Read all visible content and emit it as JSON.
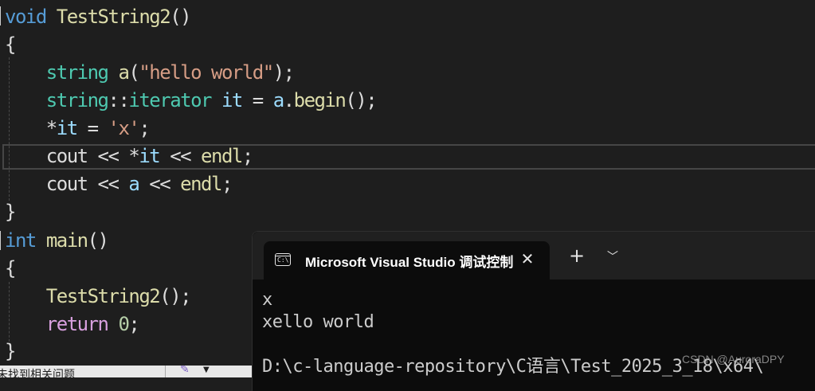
{
  "editor": {
    "func1_kw": "void",
    "func1_name": "TestString2",
    "func1_parens": "()",
    "open_brace": "{",
    "close_brace": "}",
    "l3_type": "string",
    "l3_var": "a",
    "l3_open": "(",
    "l3_str": "\"hello world\"",
    "l3_close": ");",
    "l4_type": "string",
    "l4_scope": "::",
    "l4_iter": "iterator",
    "l4_var": "it",
    "l4_eq": " = ",
    "l4_obj": "a",
    "l4_dot": ".",
    "l4_fn": "begin",
    "l4_end": "();",
    "l5_star": "*",
    "l5_var": "it",
    "l5_eq": " = ",
    "l5_char": "'x'",
    "l5_semi": ";",
    "l6_cout": "cout",
    "l6_op1": " << ",
    "l6_star": "*",
    "l6_var": "it",
    "l6_op2": " << ",
    "l6_endl": "endl",
    "l6_semi": ";",
    "l7_cout": "cout",
    "l7_op1": " << ",
    "l7_var": "a",
    "l7_op2": " << ",
    "l7_endl": "endl",
    "l7_semi": ";",
    "main_kw": "int",
    "main_name": "main",
    "main_parens": "()",
    "l11_fn": "TestString2",
    "l11_rest": "();",
    "l12_kw": "return",
    "l12_num": "0",
    "l12_semi": ";"
  },
  "statusbar": {
    "issues_label": "未找到相关问题"
  },
  "console": {
    "tab_icon_text": "C:\\",
    "tab_title": "Microsoft Visual Studio 调试控制台",
    "tab_close_icon": "close-icon",
    "new_tab_icon": "plus-icon",
    "dropdown_icon": "chevron-down-icon",
    "output": [
      "x",
      "xello world",
      "",
      "D:\\c-language-repository\\C语言\\Test_2025_3_18\\x64\\"
    ]
  },
  "watermark": "CSDN @AuroraDPY",
  "colors": {
    "background": "#1e1e1e",
    "keyword": "#569cd6",
    "type": "#4ec9b0",
    "function": "#dcdcaa",
    "variable": "#9cdcfe",
    "string": "#d69d85",
    "control": "#d8a0df",
    "console_bg": "#0c0c0c"
  }
}
